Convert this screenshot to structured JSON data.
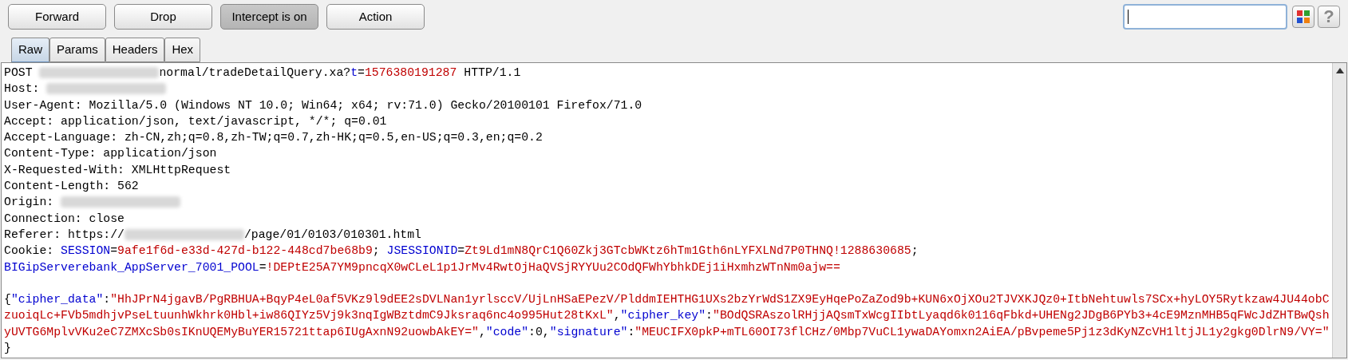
{
  "toolbar": {
    "buttons": [
      {
        "label": "Forward",
        "pressed": false
      },
      {
        "label": "Drop",
        "pressed": false
      },
      {
        "label": "Intercept is on",
        "pressed": true
      },
      {
        "label": "Action",
        "pressed": false
      }
    ]
  },
  "tabs": [
    {
      "label": "Raw",
      "selected": true
    },
    {
      "label": "Params",
      "selected": false
    },
    {
      "label": "Headers",
      "selected": false
    },
    {
      "label": "Hex",
      "selected": false
    }
  ],
  "help_button": {
    "label": "?"
  },
  "lines": [
    {
      "segments": [
        {
          "kind": "plain",
          "text": "POST "
        },
        {
          "kind": "redacted"
        },
        {
          "kind": "plain",
          "text": "normal/tradeDetailQuery.xa?"
        },
        {
          "kind": "name",
          "text": "t"
        },
        {
          "kind": "plain",
          "text": "="
        },
        {
          "kind": "value",
          "text": "1576380191287"
        },
        {
          "kind": "plain",
          "text": " HTTP/1.1"
        }
      ]
    },
    {
      "segments": [
        {
          "kind": "plain",
          "text": "Host: "
        },
        {
          "kind": "redacted"
        }
      ]
    },
    {
      "segments": [
        {
          "kind": "plain",
          "text": "User-Agent: Mozilla/5.0 (Windows NT 10.0; Win64; x64; rv:71.0) Gecko/20100101 Firefox/71.0"
        }
      ]
    },
    {
      "segments": [
        {
          "kind": "plain",
          "text": "Accept: application/json, text/javascript, */*; q=0.01"
        }
      ]
    },
    {
      "segments": [
        {
          "kind": "plain",
          "text": "Accept-Language: zh-CN,zh;q=0.8,zh-TW;q=0.7,zh-HK;q=0.5,en-US;q=0.3,en;q=0.2"
        }
      ]
    },
    {
      "segments": [
        {
          "kind": "plain",
          "text": "Content-Type: application/json"
        }
      ]
    },
    {
      "segments": [
        {
          "kind": "plain",
          "text": "X-Requested-With: XMLHttpRequest"
        }
      ]
    },
    {
      "segments": [
        {
          "kind": "plain",
          "text": "Content-Length: 562"
        }
      ]
    },
    {
      "segments": [
        {
          "kind": "plain",
          "text": "Origin: "
        },
        {
          "kind": "redacted"
        }
      ]
    },
    {
      "segments": [
        {
          "kind": "plain",
          "text": "Connection: close"
        }
      ]
    },
    {
      "segments": [
        {
          "kind": "plain",
          "text": "Referer: https://"
        },
        {
          "kind": "redacted"
        },
        {
          "kind": "plain",
          "text": "/page/01/0103/010301.html"
        }
      ]
    },
    {
      "segments": [
        {
          "kind": "plain",
          "text": "Cookie: "
        },
        {
          "kind": "name",
          "text": "SESSION"
        },
        {
          "kind": "plain",
          "text": "="
        },
        {
          "kind": "value",
          "text": "9afe1f6d-e33d-427d-b122-448cd7be68b9"
        },
        {
          "kind": "plain",
          "text": "; "
        },
        {
          "kind": "name",
          "text": "JSESSIONID"
        },
        {
          "kind": "plain",
          "text": "="
        },
        {
          "kind": "value",
          "text": "Zt9Ld1mN8QrC1Q60Zkj3GTcbWKtz6hTm1Gth6nLYFXLNd7P0THNQ!1288630685"
        },
        {
          "kind": "plain",
          "text": ";"
        }
      ]
    },
    {
      "segments": [
        {
          "kind": "name",
          "text": "BIGipServerebank_AppServer_7001_POOL"
        },
        {
          "kind": "plain",
          "text": "="
        },
        {
          "kind": "value",
          "text": "!DEPtE25A7YM9pncqX0wCLeL1p1JrMv4RwtOjHaQVSjRYYUu2COdQFWhYbhkDEj1iHxmhzWTnNm0ajw=="
        }
      ]
    },
    {
      "kind": "blank"
    },
    {
      "segments": [
        {
          "kind": "plain",
          "text": "{"
        },
        {
          "kind": "name",
          "text": "\"cipher_data\""
        },
        {
          "kind": "plain",
          "text": ":"
        },
        {
          "kind": "value",
          "text": "\"HhJPrN4jgavB/PgRBHUA+BqyP4eL0af5VKz9l9dEE2sDVLNan1yrlsccV/UjLnHSaEPezV/PlddmIEHTHG1UXs2bzYrWdS1ZX9EyHqePoZaZod9b+KUN6xOjXOu2TJVXKJQz0+ItbNehtuwls7SCx+hyLOY5Rytkzaw4JU44obC"
        }
      ]
    },
    {
      "segments": [
        {
          "kind": "value",
          "text": "zuoiqLc+FVb5mdhjvPseLtuunhWkhrk0Hbl+iw86QIYz5Vj9k3nqIgWBztdmC9Jksraq6nc4o995Hut28tKxL\""
        },
        {
          "kind": "plain",
          "text": ","
        },
        {
          "kind": "name",
          "text": "\"cipher_key\""
        },
        {
          "kind": "plain",
          "text": ":"
        },
        {
          "kind": "value",
          "text": "\"BOdQSRAszolRHjjAQsmTxWcgIIbtLyaqd6k0116qFbkd+UHENg2JDgB6PYb3+4cE9MznMHB5qFWcJdZHTBwQsh"
        }
      ]
    },
    {
      "segments": [
        {
          "kind": "value",
          "text": "yUVTG6MplvVKu2eC7ZMXcSb0sIKnUQEMyBuYER15721ttap6IUgAxnN92uowbAkEY=\""
        },
        {
          "kind": "plain",
          "text": ","
        },
        {
          "kind": "name",
          "text": "\"code\""
        },
        {
          "kind": "plain",
          "text": ":0,"
        },
        {
          "kind": "name",
          "text": "\"signature\""
        },
        {
          "kind": "plain",
          "text": ":"
        },
        {
          "kind": "value",
          "text": "\"MEUCIFX0pkP+mTL60OI73flCHz/0Mbp7VuCL1ywaDAYomxn2AiEA/pBvpeme5Pj1z3dKyNZcVH1ltjJL1y2gkg0DlrN9/VY=\""
        }
      ]
    },
    {
      "segments": [
        {
          "kind": "plain",
          "text": "}"
        }
      ]
    }
  ]
}
